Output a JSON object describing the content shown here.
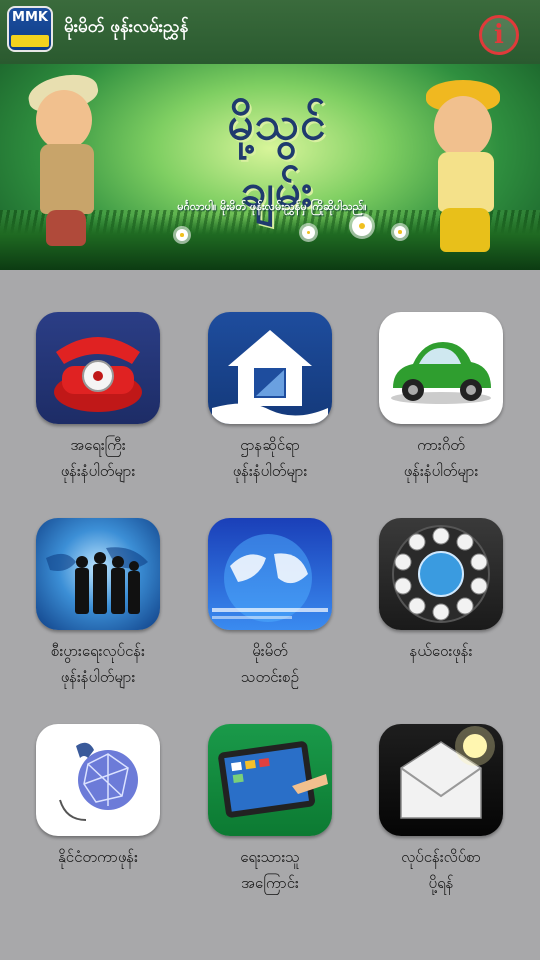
{
  "app": {
    "logo_text": "MMK",
    "title": "မိုးမိတ် ဖုန်းလမ်းညွှန်",
    "info_icon": "info-icon",
    "accent_color": "#e03a3a"
  },
  "banner": {
    "title": "မို့သွင်ချမ်း",
    "subtitle": "မင်္ဂလာပါ။ မိုးမိတ် ဖုန်းလမ်းညွှန်မှ ကြိုဆိုပါသည်။"
  },
  "tiles": [
    {
      "icon": "red-telephone-icon",
      "line1": "အရေးကြီး",
      "line2": "ဖုန်းနံပါတ်များ"
    },
    {
      "icon": "house-icon",
      "line1": "ဌာနဆိုင်ရာ",
      "line2": "ဖုန်းနံပါတ်များ"
    },
    {
      "icon": "car-icon",
      "line1": "ကားဂိတ်",
      "line2": "ဖုန်းနံပါတ်များ"
    },
    {
      "icon": "business-people-globe-icon",
      "line1": "စီးပွားရေးလုပ်ငန်း",
      "line2": "ဖုန်းနံပါတ်များ"
    },
    {
      "icon": "news-globe-icon",
      "line1": "မိုးမိတ်",
      "line2": "သတင်းစဉ်"
    },
    {
      "icon": "rotary-dial-icon",
      "line1": "နယ်ဝေးဖုန်း",
      "line2": ""
    },
    {
      "icon": "international-phone-globe-icon",
      "line1": "နိုင်ငံတကာဖုန်း",
      "line2": ""
    },
    {
      "icon": "tablet-icon",
      "line1": "ရေးသားသူ",
      "line2": "အကြောင်း"
    },
    {
      "icon": "envelope-icon",
      "line1": "လုပ်ငန်းလိပ်စာ",
      "line2": "ပို့ရန်"
    }
  ]
}
